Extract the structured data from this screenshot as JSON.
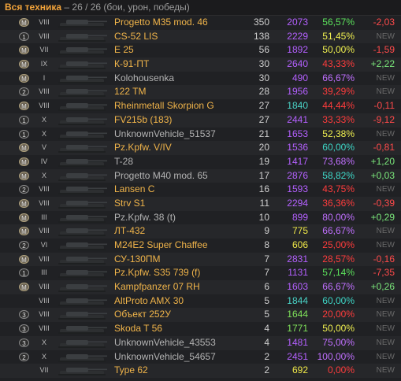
{
  "header": {
    "title": "Вся техника",
    "subtitle": " – 26 / 26 (бои, урон, победы)"
  },
  "rows": [
    {
      "mastery": "M",
      "tier": "VIII",
      "name": "Progetto M35 mod. 46",
      "battles": "350",
      "damage": "2073",
      "winrate": "56,57%",
      "diff": "-2,03",
      "elite": true,
      "wr_color": "wr-green",
      "dmg_color": "",
      "diff_color": "d-red"
    },
    {
      "mastery": "1",
      "tier": "VIII",
      "name": "CS-52 LIS",
      "battles": "138",
      "damage": "2229",
      "winrate": "51,45%",
      "diff": "NEW",
      "elite": true,
      "wr_color": "wr-yellow",
      "dmg_color": "",
      "diff_color": "new"
    },
    {
      "mastery": "M",
      "tier": "VII",
      "name": "E 25",
      "battles": "56",
      "damage": "1892",
      "winrate": "50,00%",
      "diff": "-1,59",
      "elite": true,
      "wr_color": "wr-yellow",
      "dmg_color": "",
      "diff_color": "d-red"
    },
    {
      "mastery": "M",
      "tier": "IX",
      "name": "К-91-ПТ",
      "battles": "30",
      "damage": "2640",
      "winrate": "43,33%",
      "diff": "+2,22",
      "elite": true,
      "wr_color": "wr-red",
      "dmg_color": "",
      "diff_color": "d-green"
    },
    {
      "mastery": "M",
      "tier": "I",
      "name": "Kolohousenka",
      "battles": "30",
      "damage": "490",
      "winrate": "66,67%",
      "diff": "NEW",
      "elite": false,
      "wr_color": "wr-purple",
      "dmg_color": "",
      "diff_color": "new"
    },
    {
      "mastery": "2",
      "tier": "VIII",
      "name": "122 TM",
      "battles": "28",
      "damage": "1956",
      "winrate": "39,29%",
      "diff": "NEW",
      "elite": true,
      "wr_color": "wr-red",
      "dmg_color": "",
      "diff_color": "new"
    },
    {
      "mastery": "M",
      "tier": "VIII",
      "name": "Rheinmetall Skorpion G",
      "battles": "27",
      "damage": "1840",
      "winrate": "44,44%",
      "diff": "-0,11",
      "elite": true,
      "wr_color": "wr-red",
      "dmg_color": "dmg-teal",
      "diff_color": "d-red"
    },
    {
      "mastery": "1",
      "tier": "X",
      "name": "FV215b (183)",
      "battles": "27",
      "damage": "2441",
      "winrate": "33,33%",
      "diff": "-9,12",
      "elite": true,
      "wr_color": "wr-red",
      "dmg_color": "",
      "diff_color": "d-red"
    },
    {
      "mastery": "1",
      "tier": "X",
      "name": "UnknownVehicle_51537",
      "battles": "21",
      "damage": "1653",
      "winrate": "52,38%",
      "diff": "NEW",
      "elite": false,
      "wr_color": "wr-yellow",
      "dmg_color": "",
      "diff_color": "new"
    },
    {
      "mastery": "M",
      "tier": "V",
      "name": "Pz.Kpfw. V/IV",
      "battles": "20",
      "damage": "1536",
      "winrate": "60,00%",
      "diff": "-0,81",
      "elite": true,
      "wr_color": "wr-teal",
      "dmg_color": "",
      "diff_color": "d-red"
    },
    {
      "mastery": "M",
      "tier": "IV",
      "name": "T-28",
      "battles": "19",
      "damage": "1417",
      "winrate": "73,68%",
      "diff": "+1,20",
      "elite": false,
      "wr_color": "wr-purple",
      "dmg_color": "",
      "diff_color": "d-green"
    },
    {
      "mastery": "M",
      "tier": "X",
      "name": "Progetto M40 mod. 65",
      "battles": "17",
      "damage": "2876",
      "winrate": "58,82%",
      "diff": "+0,03",
      "elite": false,
      "wr_color": "wr-teal",
      "dmg_color": "",
      "diff_color": "d-green"
    },
    {
      "mastery": "2",
      "tier": "VIII",
      "name": "Lansen C",
      "battles": "16",
      "damage": "1593",
      "winrate": "43,75%",
      "diff": "NEW",
      "elite": true,
      "wr_color": "wr-red",
      "dmg_color": "",
      "diff_color": "new"
    },
    {
      "mastery": "M",
      "tier": "VIII",
      "name": "Strv S1",
      "battles": "11",
      "damage": "2294",
      "winrate": "36,36%",
      "diff": "-0,39",
      "elite": true,
      "wr_color": "wr-red",
      "dmg_color": "",
      "diff_color": "d-red"
    },
    {
      "mastery": "M",
      "tier": "III",
      "name": "Pz.Kpfw. 38 (t)",
      "battles": "10",
      "damage": "899",
      "winrate": "80,00%",
      "diff": "+0,29",
      "elite": false,
      "wr_color": "wr-purple",
      "dmg_color": "",
      "diff_color": "d-green"
    },
    {
      "mastery": "M",
      "tier": "VIII",
      "name": "ЛТ-432",
      "battles": "9",
      "damage": "775",
      "winrate": "66,67%",
      "diff": "NEW",
      "elite": true,
      "wr_color": "wr-purple",
      "dmg_color": "dmg-yellow",
      "diff_color": "new"
    },
    {
      "mastery": "2",
      "tier": "VI",
      "name": "M24E2 Super Chaffee",
      "battles": "8",
      "damage": "606",
      "winrate": "25,00%",
      "diff": "NEW",
      "elite": true,
      "wr_color": "wr-red",
      "dmg_color": "dmg-yellow",
      "diff_color": "new"
    },
    {
      "mastery": "M",
      "tier": "VIII",
      "name": "СУ-130ПМ",
      "battles": "7",
      "damage": "2831",
      "winrate": "28,57%",
      "diff": "-0,16",
      "elite": true,
      "wr_color": "wr-red",
      "dmg_color": "",
      "diff_color": "d-red"
    },
    {
      "mastery": "1",
      "tier": "III",
      "name": "Pz.Kpfw. S35 739 (f)",
      "battles": "7",
      "damage": "1131",
      "winrate": "57,14%",
      "diff": "-7,35",
      "elite": true,
      "wr_color": "wr-green",
      "dmg_color": "",
      "diff_color": "d-red"
    },
    {
      "mastery": "M",
      "tier": "VIII",
      "name": "Kampfpanzer 07 RH",
      "battles": "6",
      "damage": "1603",
      "winrate": "66,67%",
      "diff": "+0,26",
      "elite": true,
      "wr_color": "wr-purple",
      "dmg_color": "",
      "diff_color": "d-green"
    },
    {
      "mastery": "",
      "tier": "VIII",
      "name": "AltProto AMX 30",
      "battles": "5",
      "damage": "1844",
      "winrate": "60,00%",
      "diff": "NEW",
      "elite": true,
      "wr_color": "wr-teal",
      "dmg_color": "dmg-teal",
      "diff_color": "new"
    },
    {
      "mastery": "3",
      "tier": "VIII",
      "name": "Объект 252У",
      "battles": "5",
      "damage": "1644",
      "winrate": "20,00%",
      "diff": "NEW",
      "elite": true,
      "wr_color": "wr-red",
      "dmg_color": "dmg-green",
      "diff_color": "new"
    },
    {
      "mastery": "3",
      "tier": "VIII",
      "name": "Skoda T 56",
      "battles": "4",
      "damage": "1771",
      "winrate": "50,00%",
      "diff": "NEW",
      "elite": true,
      "wr_color": "wr-yellow",
      "dmg_color": "dmg-green",
      "diff_color": "new"
    },
    {
      "mastery": "3",
      "tier": "X",
      "name": "UnknownVehicle_43553",
      "battles": "4",
      "damage": "1481",
      "winrate": "75,00%",
      "diff": "NEW",
      "elite": false,
      "wr_color": "wr-purple",
      "dmg_color": "",
      "diff_color": "new"
    },
    {
      "mastery": "2",
      "tier": "X",
      "name": "UnknownVehicle_54657",
      "battles": "2",
      "damage": "2451",
      "winrate": "100,00%",
      "diff": "NEW",
      "elite": false,
      "wr_color": "wr-purple",
      "dmg_color": "",
      "diff_color": "new"
    },
    {
      "mastery": "",
      "tier": "VII",
      "name": "Type 62",
      "battles": "2",
      "damage": "692",
      "winrate": "0,00%",
      "diff": "NEW",
      "elite": true,
      "wr_color": "wr-red",
      "dmg_color": "dmg-yellow",
      "diff_color": "new"
    }
  ]
}
